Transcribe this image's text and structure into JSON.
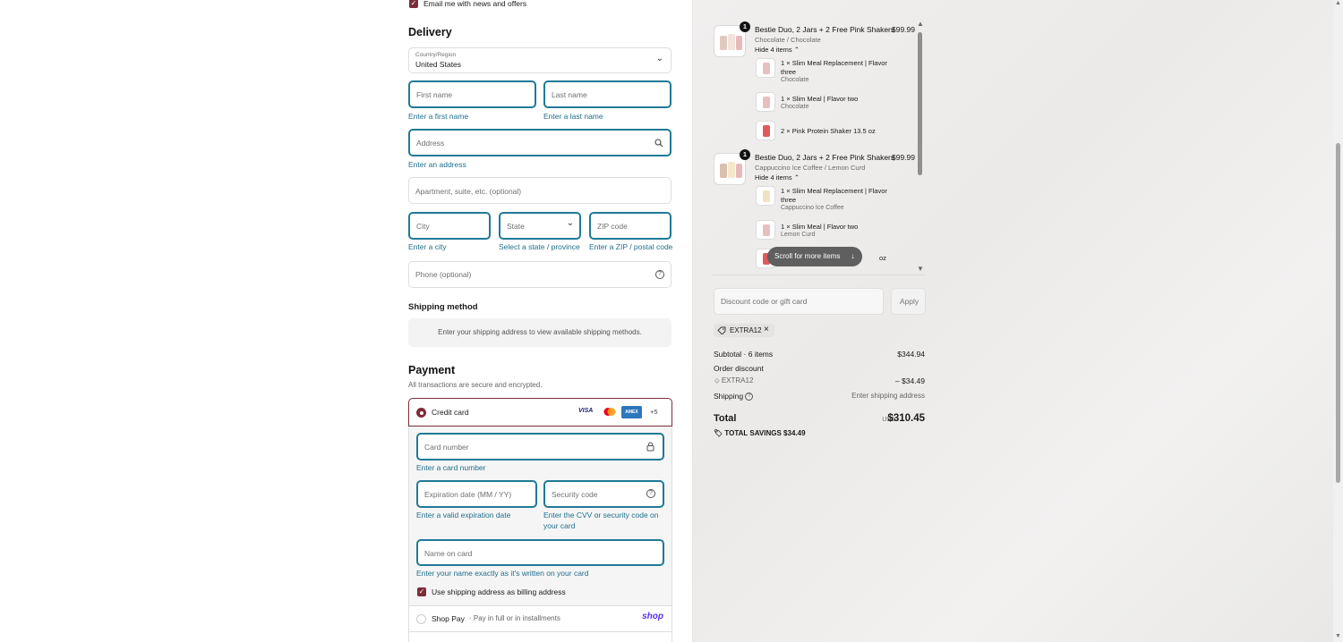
{
  "email_optin": {
    "label": "Email me with news and offers",
    "checked": true
  },
  "delivery": {
    "heading": "Delivery",
    "country_label": "Country/Region",
    "country_value": "United States",
    "first_name_ph": "First name",
    "first_name_err": "Enter a first name",
    "last_name_ph": "Last name",
    "last_name_err": "Enter a last name",
    "address_ph": "Address",
    "address_err": "Enter an address",
    "apartment_ph": "Apartment, suite, etc. (optional)",
    "city_ph": "City",
    "city_err": "Enter a city",
    "state_ph": "State",
    "state_err": "Select a state / province",
    "zip_ph": "ZIP code",
    "zip_err": "Enter a ZIP / postal code",
    "phone_ph": "Phone (optional)"
  },
  "shipping_method": {
    "heading": "Shipping method",
    "note": "Enter your shipping address to view available shipping methods."
  },
  "payment": {
    "heading": "Payment",
    "subtitle": "All transactions are secure and encrypted.",
    "credit_card_label": "Credit card",
    "card_brands": [
      "VISA",
      "MC",
      "AMEX"
    ],
    "more_brands": "+5",
    "card_number_ph": "Card number",
    "card_number_err": "Enter a card number",
    "expiry_ph": "Expiration date (MM / YY)",
    "expiry_err": "Enter a valid expiration date",
    "cvv_ph": "Security code",
    "cvv_err_1": "Enter the CVV or security code on",
    "cvv_err_2": "your card",
    "name_ph": "Name on card",
    "name_err": "Enter your name exactly as it's written on your card",
    "billing_same_label": "Use shipping address as billing address",
    "shop_pay_label": "Shop Pay",
    "shop_pay_sub": "· Pay in full or in installments",
    "shop_pay_logo": "shop"
  },
  "summary": {
    "items": [
      {
        "qty": "1",
        "title": "Bestie Duo, 2 Jars + 2 Free Pink Shakers",
        "variant": "Chocolate / Chocolate",
        "price": "$99.99",
        "toggle": "Hide 4 items",
        "subitems": [
          {
            "title_1": "1 × Slim Meal Replacement | Flavor",
            "title_2": "three",
            "variant": "Chocolate"
          },
          {
            "title_1": "1 × Slim Meal | Flavor two",
            "title_2": "",
            "variant": "Chocolate"
          },
          {
            "title_1": "2 × Pink Protein Shaker 13.5 oz",
            "title_2": "",
            "variant": ""
          }
        ]
      },
      {
        "qty": "1",
        "title": "Bestie Duo, 2 Jars + 2 Free Pink Shakers",
        "variant": "Cappuccino Ice Coffee / Lemon Curd",
        "price": "$99.99",
        "toggle": "Hide 4 items",
        "subitems": [
          {
            "title_1": "1 × Slim Meal Replacement | Flavor",
            "title_2": "three",
            "variant": "Cappuccino Ice Coffee"
          },
          {
            "title_1": "1 × Slim Meal | Flavor two",
            "title_2": "",
            "variant": "Lemon Curd"
          },
          {
            "title_1": "oz",
            "title_2": "",
            "variant": ""
          }
        ]
      }
    ],
    "scroll_more": "Scroll for more items",
    "discount_ph": "Discount code or gift card",
    "apply_label": "Apply",
    "applied_code": "EXTRA12",
    "subtotal_label": "Subtotal · 6 items",
    "subtotal_value": "$344.94",
    "order_discount_label": "Order discount",
    "discount_code": "EXTRA12",
    "discount_value": "– $34.49",
    "shipping_label": "Shipping",
    "shipping_value": "Enter shipping address",
    "total_label": "Total",
    "currency": "USD",
    "total_value": "$310.45",
    "savings_label": "TOTAL SAVINGS",
    "savings_value": "$34.49"
  },
  "colors": {
    "accent": "#1f7a96",
    "checkbox": "#7a2e39",
    "error_text": "#1f6f8b",
    "shop_brand": "#5a31f4"
  }
}
